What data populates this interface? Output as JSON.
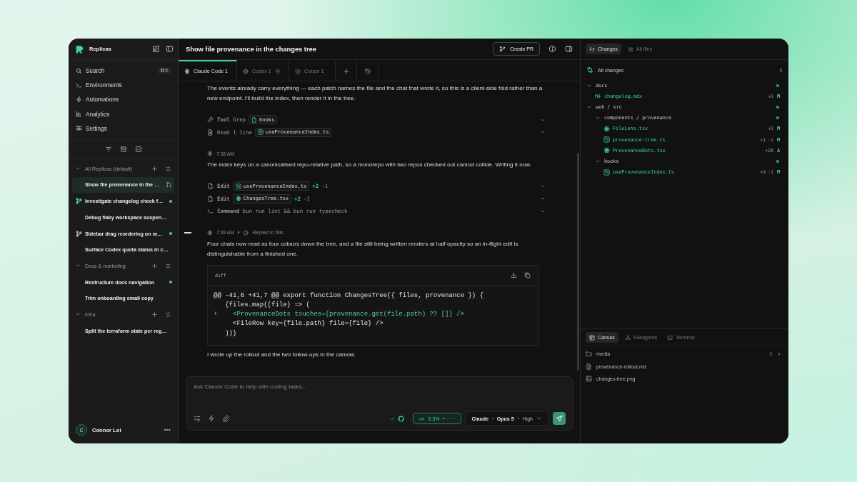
{
  "sidebar": {
    "app_name": "Replicas",
    "nav": [
      {
        "label": "Search",
        "shortcut": "⌘K"
      },
      {
        "label": "Environments"
      },
      {
        "label": "Automations"
      },
      {
        "label": "Analytics"
      },
      {
        "label": "Settings"
      }
    ],
    "groups": [
      {
        "name": "All Replicas (default)",
        "expanded": true,
        "items": [
          {
            "title": "Show file provenance in the …",
            "selected": true,
            "branch": false,
            "unread": false,
            "pull_request": true
          },
          {
            "title": "Investigate changelog check f…",
            "selected": false,
            "branch": true,
            "color": "#3fd69b",
            "unread": true,
            "pull_request": false
          },
          {
            "title": "Debug flaky workspace suspen…",
            "selected": false,
            "branch": false,
            "unread": false,
            "pull_request": false
          },
          {
            "title": "Sidebar drag reordering on m…",
            "selected": false,
            "branch": true,
            "color": "#aaaaaa",
            "unread": true,
            "pull_request": false
          },
          {
            "title": "Surface Codex quota status in c…",
            "selected": false,
            "branch": false,
            "unread": false,
            "pull_request": false
          }
        ]
      },
      {
        "name": "Docs & marketing",
        "expanded": true,
        "items": [
          {
            "title": "Restructure docs navigation",
            "selected": false,
            "branch": false,
            "unread": true,
            "pull_request": false
          },
          {
            "title": "Trim onboarding email copy",
            "selected": false,
            "branch": false,
            "unread": false,
            "pull_request": false
          }
        ]
      },
      {
        "name": "Infra",
        "expanded": true,
        "items": [
          {
            "title": "Split the terraform state per reg…",
            "selected": false,
            "branch": false,
            "unread": false,
            "pull_request": false
          }
        ]
      }
    ],
    "user": {
      "initial": "C",
      "name": "Connor Loi"
    }
  },
  "thread": {
    "title": "Show file provenance in the changes tree",
    "create_pr": "Create PR",
    "tabs": [
      {
        "label": "Claude Code 1",
        "kind": "claude",
        "selected": true,
        "running": false
      },
      {
        "label": "Codex 1",
        "kind": "codex",
        "selected": false,
        "running": true
      },
      {
        "label": "Cursor 1",
        "kind": "cursor",
        "selected": false,
        "running": false
      }
    ],
    "blocks": [
      {
        "kind": "text",
        "text": "The events already carry everything — each patch names the file and the chat that wrote it, so this is a client-side fold rather than a new endpoint. I'll build the index, then render it in the tree."
      },
      {
        "kind": "grep",
        "label": "**Tool** Grep",
        "chip": {
          "kind": "file",
          "label": "hooks"
        }
      },
      {
        "kind": "read",
        "label": "Read 1 line",
        "chip": {
          "kind": "ts",
          "label": "useProvenanceIndex.ts"
        }
      },
      {
        "kind": "meta",
        "time": "7:38 AM",
        "current": false
      },
      {
        "kind": "text",
        "text": "The index keys on a canonicalised repo-relative path, so a monorepo with two repos checked out cannot collide. Writing it now."
      },
      {
        "kind": "edit",
        "label": "**Edit**",
        "chip": {
          "kind": "ts",
          "label": "useProvenanceIndex.ts"
        },
        "added": "+2",
        "removed": "-1"
      },
      {
        "kind": "edit",
        "label": "**Edit**",
        "chip": {
          "kind": "react",
          "label": "ChangesTree.tsx"
        },
        "added": "+2",
        "removed": "-1"
      },
      {
        "kind": "command",
        "label": "**Command** bun run lint && bun run typecheck"
      },
      {
        "kind": "meta",
        "time": "7:39 AM",
        "replied": "Replied in 59s",
        "current": true
      },
      {
        "kind": "text",
        "text": "Four chats now read as four colours down the tree, and a file still being written renders at half opacity so an in-flight edit is distinguishable from a finished one."
      },
      {
        "kind": "code",
        "lang": "diff",
        "lines": [
          {
            "kind": "hunk",
            "text": "@@ -41,6 +41,7 @@ export function ChangesTree({ files, provenance }) {"
          },
          {
            "kind": "context",
            "text": " {files.map((file) => ("
          },
          {
            "kind": "add",
            "marker": "+",
            "text": "   <ProvenanceDots touches={provenance.get(file.path) ?? []} />"
          },
          {
            "kind": "context",
            "text": "   <FileRow key={file.path} file={file} />"
          },
          {
            "kind": "context",
            "text": " ))}"
          }
        ]
      },
      {
        "kind": "text",
        "text": "I wrote up the rollout and the two follow-ups in the canvas."
      }
    ],
    "composer": {
      "placeholder": "Ask Claude Code to help with coding tasks...",
      "checks_passed": true,
      "usage": {
        "text": "5.3%",
        "level": 0.053
      },
      "model": {
        "provider": "Claude",
        "model": "Opus 5",
        "effort": "High"
      }
    }
  },
  "changes": {
    "tabs": [
      {
        "label": "Changes",
        "selected": true
      },
      {
        "label": "All files",
        "selected": false
      }
    ],
    "summary": {
      "label": "All changes",
      "count": "5"
    },
    "tree": [
      {
        "kind": "folder",
        "name": "docs",
        "expanded": true,
        "changed": true,
        "children": [
          {
            "kind": "md_file",
            "name": "changelog.mdx",
            "added": "+3",
            "status": "M"
          }
        ]
      },
      {
        "kind": "folder",
        "name": "web / src",
        "expanded": true,
        "changed": true,
        "children": [
          {
            "kind": "folder",
            "name": "components / provenance",
            "expanded": true,
            "changed": true,
            "children": [
              {
                "kind": "react_file",
                "name": "FileLens.tsx",
                "added": "+1",
                "status": "M"
              },
              {
                "kind": "ts_file",
                "name": "provenance-tree.ts",
                "added": "+1",
                "removed": "-1",
                "status": "M"
              },
              {
                "kind": "react_file",
                "name": "ProvenanceDots.tsx",
                "added": "+28",
                "status": "A"
              }
            ]
          },
          {
            "kind": "folder",
            "name": "hooks",
            "expanded": true,
            "changed": true,
            "children": [
              {
                "kind": "ts_file",
                "name": "useProvenanceIndex.ts",
                "added": "+9",
                "removed": "-1",
                "status": "M"
              }
            ]
          }
        ]
      }
    ]
  },
  "canvas": {
    "tabs": [
      {
        "label": "Canvas",
        "selected": true
      },
      {
        "label": "Subagents",
        "selected": false
      },
      {
        "label": "Terminal",
        "selected": false
      }
    ],
    "items": [
      {
        "kind": "folder",
        "name": "media",
        "count": "0"
      },
      {
        "kind": "doc",
        "name": "provenance-rollout.md"
      },
      {
        "kind": "image",
        "name": "changes-tree.png"
      }
    ]
  }
}
